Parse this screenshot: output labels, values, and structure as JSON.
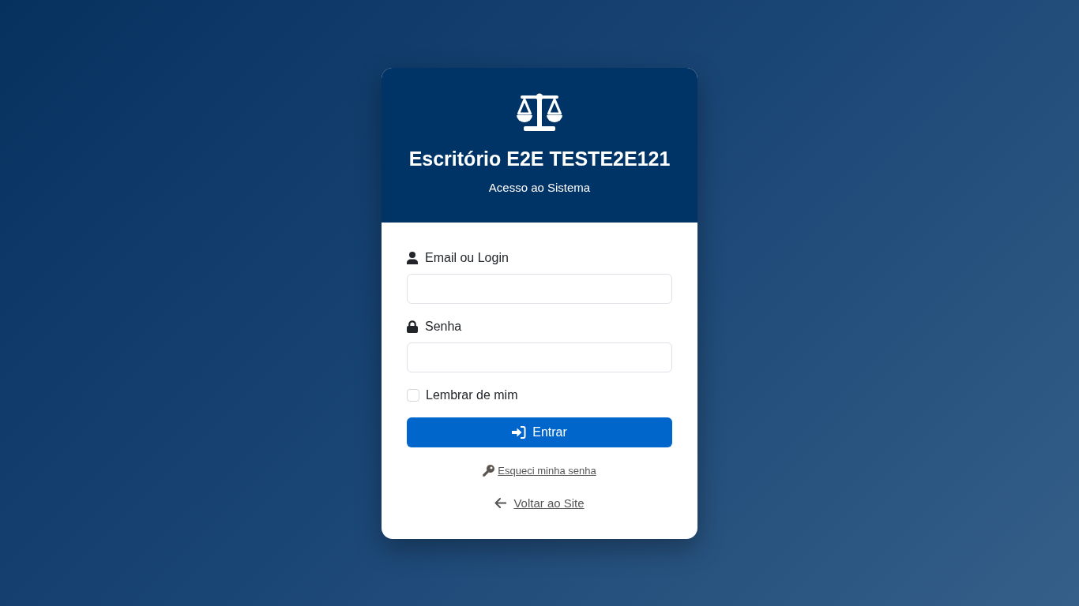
{
  "header": {
    "title": "Escritório E2E TESTE2E121",
    "subtitle": "Acesso ao Sistema"
  },
  "form": {
    "fields": [
      {
        "label": "Email ou Login",
        "kind": "text"
      },
      {
        "label": "Senha",
        "kind": "password"
      }
    ],
    "remember": {
      "label": "Lembrar de mim",
      "checked": false
    },
    "submit": {
      "label": "Entrar"
    }
  },
  "links": [
    {
      "label": "Esqueci minha senha",
      "kind": "forgot"
    },
    {
      "label": "Voltar ao Site",
      "kind": "back"
    }
  ]
}
